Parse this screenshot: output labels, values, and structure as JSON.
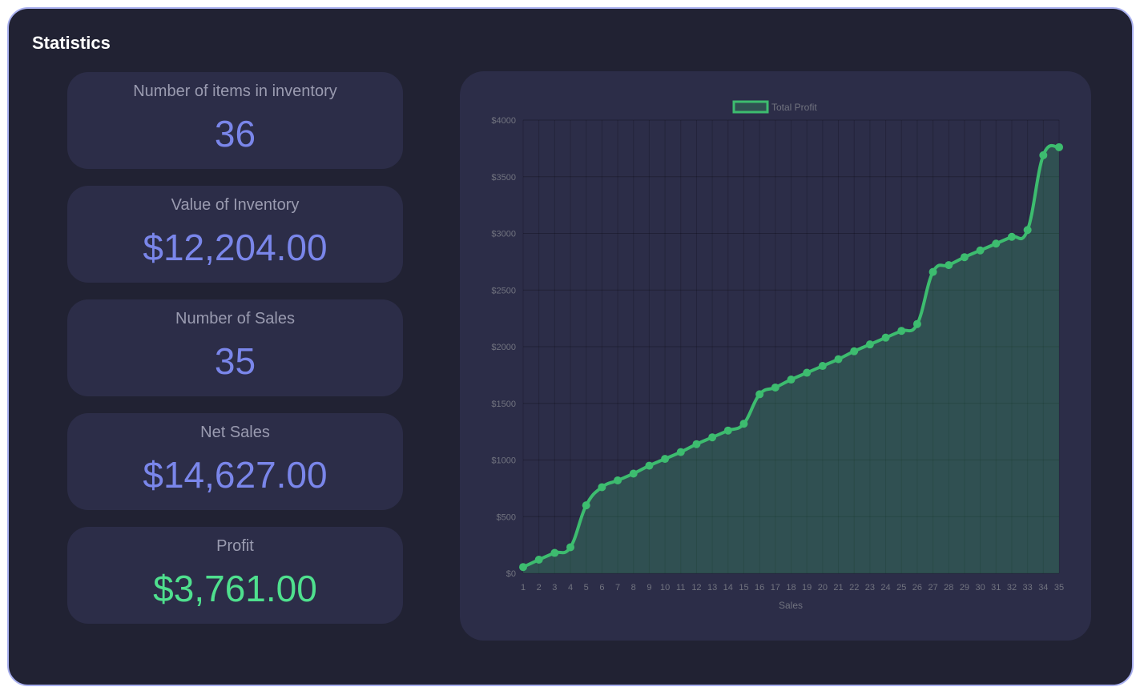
{
  "title": "Statistics",
  "colors": {
    "accent": "#7a86ea",
    "profit": "#4fe08e",
    "line": "#3dbc6f",
    "card": "#2c2d48",
    "background": "#212233"
  },
  "stats": [
    {
      "label": "Number of items in inventory",
      "value": "36"
    },
    {
      "label": "Value of Inventory",
      "value": "$12,204.00"
    },
    {
      "label": "Number of Sales",
      "value": "35"
    },
    {
      "label": "Net Sales",
      "value": "$14,627.00"
    },
    {
      "label": "Profit",
      "value": "$3,761.00"
    }
  ],
  "chart_data": {
    "type": "line",
    "legend": "Total Profit",
    "legend_position": "top",
    "xlabel": "Sales",
    "ylabel": "",
    "ylim": [
      0,
      4000
    ],
    "yticks": [
      "$0",
      "$500",
      "$1000",
      "$1500",
      "$2000",
      "$2500",
      "$3000",
      "$3500",
      "$4000"
    ],
    "ytick_values": [
      0,
      500,
      1000,
      1500,
      2000,
      2500,
      3000,
      3500,
      4000
    ],
    "grid": true,
    "fill": true,
    "categories": [
      "1",
      "2",
      "3",
      "4",
      "5",
      "6",
      "7",
      "8",
      "9",
      "10",
      "11",
      "12",
      "13",
      "14",
      "15",
      "16",
      "17",
      "18",
      "19",
      "20",
      "21",
      "22",
      "23",
      "24",
      "25",
      "26",
      "27",
      "28",
      "29",
      "30",
      "31",
      "32",
      "33",
      "34",
      "35"
    ],
    "series": [
      {
        "name": "Total Profit",
        "values": [
          55,
          120,
          180,
          230,
          600,
          760,
          820,
          880,
          950,
          1010,
          1070,
          1140,
          1200,
          1260,
          1320,
          1580,
          1640,
          1710,
          1770,
          1830,
          1890,
          1960,
          2020,
          2080,
          2140,
          2200,
          2660,
          2720,
          2790,
          2850,
          2910,
          2970,
          3030,
          3690,
          3761
        ]
      }
    ]
  }
}
